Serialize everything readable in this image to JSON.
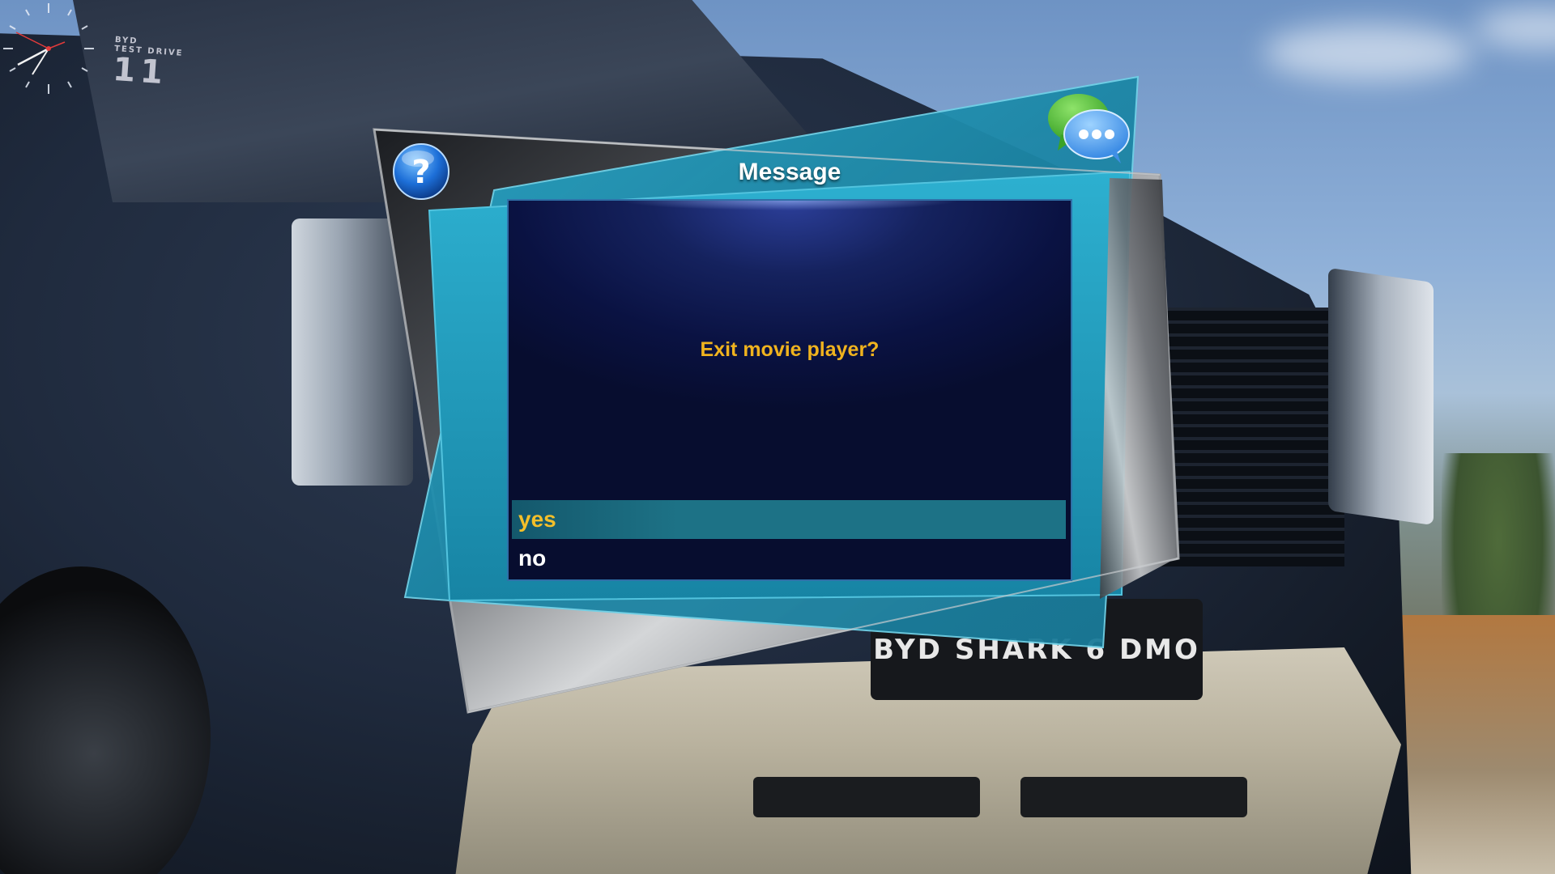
{
  "dialog": {
    "title": "Message",
    "message": "Exit movie player?",
    "options": [
      {
        "label": "yes",
        "selected": true
      },
      {
        "label": "no",
        "selected": false
      }
    ]
  },
  "background": {
    "plate_text": "BYD SHARK 6 DMO",
    "windshield_sticker_top": "BYD",
    "windshield_sticker_middle": "TEST DRIVE",
    "windshield_sticker_number": "11"
  },
  "icons": {
    "help": "help-icon",
    "chat": "chat-icon",
    "clock": "clock-icon"
  },
  "colors": {
    "message_text": "#f0b31e",
    "selected_option_text": "#f3bf2a",
    "selected_option_bg": "#1d7286",
    "panel_bg": "#0a1242",
    "frame_teal": "#1e90b0"
  }
}
